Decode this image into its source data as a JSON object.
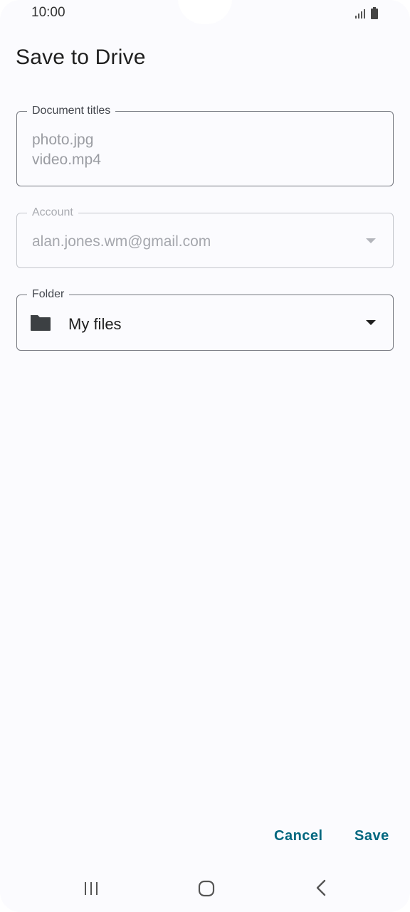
{
  "status_bar": {
    "time": "10:00",
    "icons": [
      "signal-icon",
      "battery-icon"
    ]
  },
  "dialog": {
    "title": "Save to Drive",
    "document_titles": {
      "label": "Document titles",
      "lines": [
        "photo.jpg",
        "video.mp4"
      ]
    },
    "account": {
      "label": "Account",
      "value": "alan.jones.wm@gmail.com",
      "enabled": false
    },
    "folder": {
      "label": "Folder",
      "value": "My files",
      "icon": "folder-icon"
    },
    "actions": {
      "cancel_label": "Cancel",
      "save_label": "Save"
    }
  },
  "navigation_bar": {
    "icons": [
      "recents-icon",
      "home-icon",
      "back-icon"
    ]
  },
  "colors": {
    "accent": "#00677f",
    "background": "#fbfbfe",
    "outline": "#74777f",
    "disabled_outline": "#c4c6cc"
  }
}
